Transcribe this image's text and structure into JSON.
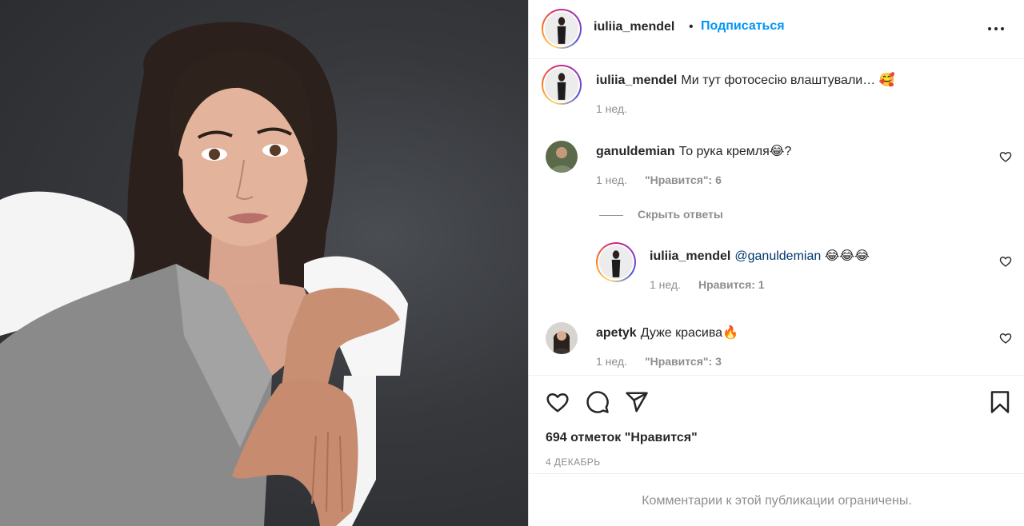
{
  "post": {
    "author": "iuliia_mendel",
    "dot": "•",
    "follow_label": "Подписаться",
    "caption": "Ми тут фотосесію влаштували… 🥰",
    "caption_time": "1 нед."
  },
  "comments": [
    {
      "username": "ganuldemian",
      "text": "То рука кремля😂?",
      "time": "1 нед.",
      "likes": "\"Нравится\": 6"
    },
    {
      "username": "apetyk",
      "text": "Дуже красива🔥",
      "time": "1 нед.",
      "likes": "\"Нравится\": 3"
    }
  ],
  "hide_replies_label": "Скрыть ответы",
  "reply": {
    "username": "iuliia_mendel",
    "mention": "@ganuldemian",
    "text": " 😂😂😂",
    "time": "1 нед.",
    "likes": "Нравится: 1"
  },
  "like_count_text": "694 отметок \"Нравится\"",
  "date_text": "4 ДЕКАБРЬ",
  "comments_restricted": "Комментарии к этой публикации ограничены.",
  "icons": {
    "more": "more-horizontal-icon",
    "like": "heart-icon",
    "comment": "comment-icon",
    "share": "send-icon",
    "save": "bookmark-icon"
  },
  "colors": {
    "link_blue": "#0095f6",
    "mention": "#00376b",
    "text": "#262626",
    "secondary": "#8e8e8e"
  }
}
